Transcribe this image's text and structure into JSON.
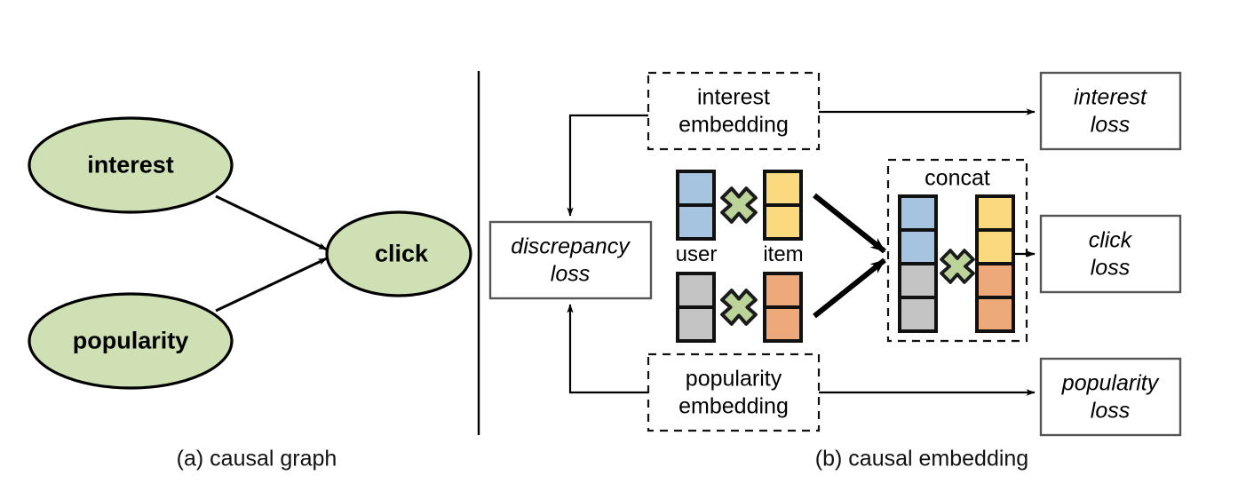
{
  "figure": {
    "panel_a_caption": "(a) causal graph",
    "panel_b_caption": "(b) causal embedding"
  },
  "colors": {
    "ellipse_fill": "#cfe0b4",
    "ellipse_stroke": "#000000",
    "user_interest_block": "#a6c3e0",
    "item_interest_block": "#fad97f",
    "user_popularity_block": "#c4c4c4",
    "item_popularity_block": "#eda97a",
    "multiply_fill": "#bcd49a",
    "multiply_stroke": "#1b1b1b",
    "box_stroke": "#555555",
    "arrow": "#000000"
  },
  "panel_a": {
    "nodes": [
      {
        "id": "interest",
        "label": "interest"
      },
      {
        "id": "popularity",
        "label": "popularity"
      },
      {
        "id": "click",
        "label": "click"
      }
    ],
    "edges": [
      {
        "from": "interest",
        "to": "click"
      },
      {
        "from": "popularity",
        "to": "click"
      }
    ]
  },
  "panel_b": {
    "discrepancy_loss": {
      "line1": "discrepancy",
      "line2": "loss"
    },
    "interest_embedding": {
      "line1": "interest",
      "line2": "embedding"
    },
    "popularity_embedding": {
      "line1": "popularity",
      "line2": "embedding"
    },
    "interest_loss": {
      "line1": "interest",
      "line2": "loss"
    },
    "click_loss": {
      "line1": "click",
      "line2": "loss"
    },
    "popularity_loss": {
      "line1": "popularity",
      "line2": "loss"
    },
    "concat_label": "concat",
    "vector_labels": {
      "user": "user",
      "item": "item"
    },
    "operator": "×",
    "embedding_rows": [
      {
        "name": "interest-row",
        "user_cells": 2,
        "item_cells": 2,
        "user_color": "#a6c3e0",
        "item_color": "#fad97f"
      },
      {
        "name": "popularity-row",
        "user_cells": 2,
        "item_cells": 2,
        "user_color": "#c4c4c4",
        "item_color": "#eda97a"
      }
    ],
    "concat": {
      "user_stack": [
        "#a6c3e0",
        "#a6c3e0",
        "#c4c4c4",
        "#c4c4c4"
      ],
      "item_stack": [
        "#fad97f",
        "#fad97f",
        "#eda97a",
        "#eda97a"
      ]
    }
  }
}
